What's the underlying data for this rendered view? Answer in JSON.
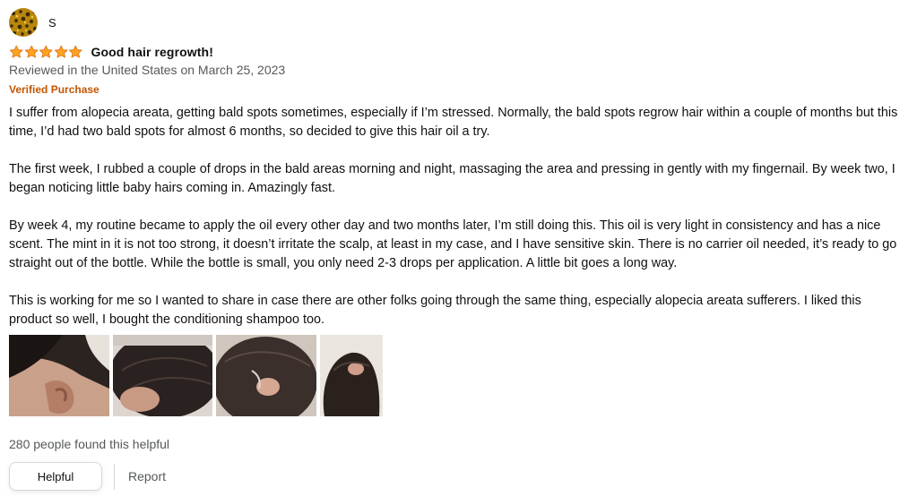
{
  "profile": {
    "name": "S",
    "avatar_icon": "avatar-pattern-icon"
  },
  "review": {
    "rating": 5,
    "max_rating": 5,
    "star_color": "#ffa41c",
    "title": "Good hair regrowth!",
    "date_line": "Reviewed in the United States on March 25, 2023",
    "verified_label": "Verified Purchase",
    "verified_color": "#c45500",
    "paragraphs": [
      "I suffer from alopecia areata, getting bald spots sometimes, especially if I’m stressed. Normally, the bald spots regrow hair within a couple of months but this time, I’d had two bald spots for almost 6 months, so decided to give this hair oil a try.",
      "The first week, I rubbed a couple of drops in the bald areas morning and night, massaging the area and pressing in gently with my fingernail. By week two, I began noticing little baby hairs coming in. Amazingly fast.",
      "By week 4, my routine became to apply the oil every other day and two months later, I’m still doing this. This oil is very light in consistency and has a nice scent. The mint in it is not too strong, it doesn’t irritate the scalp, at least in my case, and I have sensitive skin. There is no carrier oil needed, it’s ready to go straight out of the bottle. While the bottle is small, you only need 2-3 drops per application. A little bit goes a long way.",
      "This is working for me so I wanted to share in case there are other folks going through the same thing, especially alopecia areata sufferers. I liked this product so well, I bought the conditioning shampoo too."
    ],
    "image_count": 4,
    "helpful_count_text": "280 people found this helpful"
  },
  "actions": {
    "helpful_label": "Helpful",
    "report_label": "Report"
  }
}
